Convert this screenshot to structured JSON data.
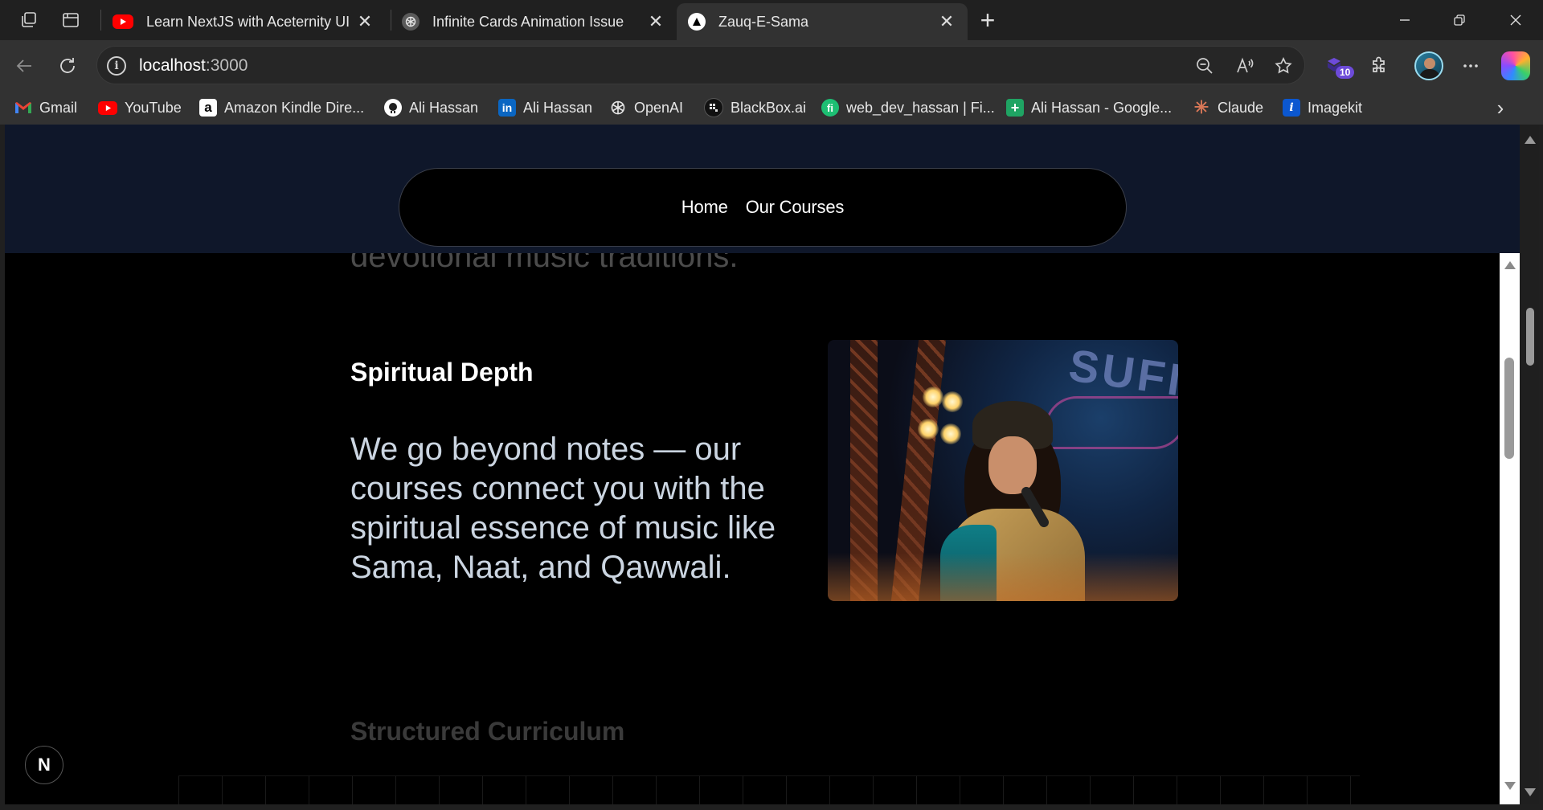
{
  "browser": {
    "tabs": [
      {
        "title": "Learn NextJS with Aceternity UI lib",
        "icon": "youtube-icon",
        "active": false
      },
      {
        "title": "Infinite Cards Animation Issue",
        "icon": "openai-icon",
        "active": false
      },
      {
        "title": "Zauq-E-Sama",
        "icon": "triangle-logo-icon",
        "active": true
      }
    ],
    "address": {
      "host": "localhost",
      "port": ":3000"
    },
    "extension_badge": "10",
    "bookmarks": [
      {
        "label": "Gmail",
        "icon": "gmail-icon"
      },
      {
        "label": "YouTube",
        "icon": "youtube-icon"
      },
      {
        "label": "Amazon Kindle Dire...",
        "icon": "amazon-icon"
      },
      {
        "label": "Ali Hassan",
        "icon": "github-icon"
      },
      {
        "label": "Ali Hassan",
        "icon": "linkedin-icon"
      },
      {
        "label": "OpenAI",
        "icon": "openai-icon"
      },
      {
        "label": "BlackBox.ai",
        "icon": "blackbox-icon"
      },
      {
        "label": "web_dev_hassan | Fi...",
        "icon": "fiverr-icon"
      },
      {
        "label": "Ali Hassan - Google...",
        "icon": "google-sheets-icon"
      },
      {
        "label": "Claude",
        "icon": "claude-icon"
      },
      {
        "label": "Imagekit",
        "icon": "imagekit-icon"
      }
    ]
  },
  "page": {
    "nav": {
      "items": [
        "Home",
        "Our Courses"
      ]
    },
    "previous_text_fragment": "devotional music traditions.",
    "section": {
      "title": "Spiritual Depth",
      "text": "We go beyond notes — our courses connect you with the spiritual essence of music like Sama, Naat, and Qawwali.",
      "image_sign_text": "SUFI"
    },
    "next_section_title": "Structured Curriculum",
    "dev_badge": "N"
  },
  "colors": {
    "header_band": "#0f172a",
    "page_bg": "#000000",
    "body_text": "#cbd5e1",
    "browser_chrome": "#323232",
    "tab_strip": "#202020"
  }
}
